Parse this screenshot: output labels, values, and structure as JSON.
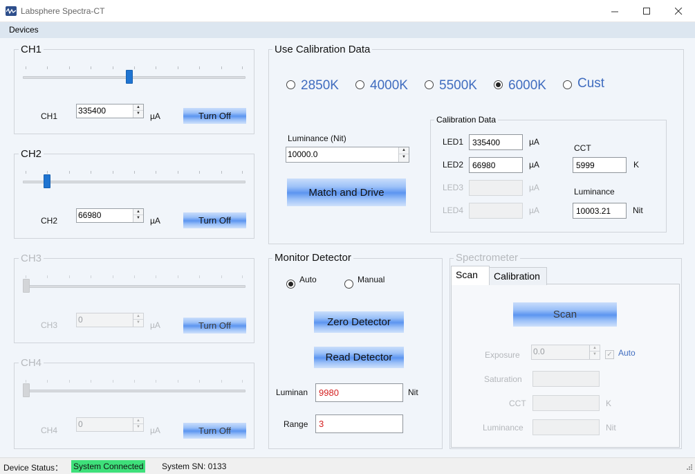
{
  "window": {
    "title": "Labsphere Spectra-CT",
    "minimize_icon": "minimize-icon",
    "maximize_icon": "maximize-icon",
    "close_icon": "close-icon"
  },
  "menu": {
    "devices": "Devices"
  },
  "channels": [
    {
      "title": "CH1",
      "label": "CH1",
      "value": "335400",
      "unit": "µA",
      "button": "Turn Off",
      "enabled": true
    },
    {
      "title": "CH2",
      "label": "CH2",
      "value": "66980",
      "unit": "µA",
      "button": "Turn Off",
      "enabled": true
    },
    {
      "title": "CH3",
      "label": "CH3",
      "value": "0",
      "unit": "µA",
      "button": "Turn Off",
      "enabled": false
    },
    {
      "title": "CH4",
      "label": "CH4",
      "value": "0",
      "unit": "µA",
      "button": "Turn Off",
      "enabled": false
    }
  ],
  "calibration": {
    "title": "Use Calibration Data",
    "options": [
      "2850K",
      "4000K",
      "5500K",
      "6000K",
      "Cust"
    ],
    "selected": "6000K",
    "luminance_label": "Luminance (Nit)",
    "luminance_value": "10000.0",
    "match_button": "Match and Drive",
    "data": {
      "title": "Calibration Data",
      "led1_label": "LED1",
      "led1_value": "335400",
      "led1_unit": "µA",
      "led2_label": "LED2",
      "led2_value": "66980",
      "led2_unit": "µA",
      "led3_label": "LED3",
      "led3_value": "",
      "led3_unit": "µA",
      "led4_label": "LED4",
      "led4_value": "",
      "led4_unit": "µA",
      "cct_label": "CCT",
      "cct_value": "5999",
      "cct_unit": "K",
      "lum_label": "Luminance",
      "lum_value": "10003.21",
      "lum_unit": "Nit"
    }
  },
  "monitor": {
    "title": "Monitor Detector",
    "auto_label": "Auto",
    "manual_label": "Manual",
    "mode": "Auto",
    "zero_button": "Zero Detector",
    "read_button": "Read Detector",
    "luminan_label": "Luminan",
    "luminan_value": "9980",
    "luminan_unit": "Nit",
    "range_label": "Range",
    "range_value": "3"
  },
  "spectrometer": {
    "title": "Spectrometer",
    "tabs": [
      "Scan",
      "Calibration"
    ],
    "active_tab": "Scan",
    "scan_button": "Scan",
    "exposure_label": "Exposure",
    "exposure_value": "0.0",
    "auto_label": "Auto",
    "auto_checked": true,
    "saturation_label": "Saturation",
    "saturation_value": "",
    "cct_label": "CCT",
    "cct_value": "",
    "cct_unit": "K",
    "luminance_label": "Luminance",
    "luminance_value": "",
    "luminance_unit": "Nit"
  },
  "status": {
    "device_label": "Device Status：",
    "connection": "System Connected",
    "connection_color": "#3ee07a",
    "serial": "System SN: 0133"
  },
  "colors": {
    "accent": "#1f74d1",
    "ctk_blue": "#3f6cbf",
    "readout_red": "#d41f1f"
  }
}
